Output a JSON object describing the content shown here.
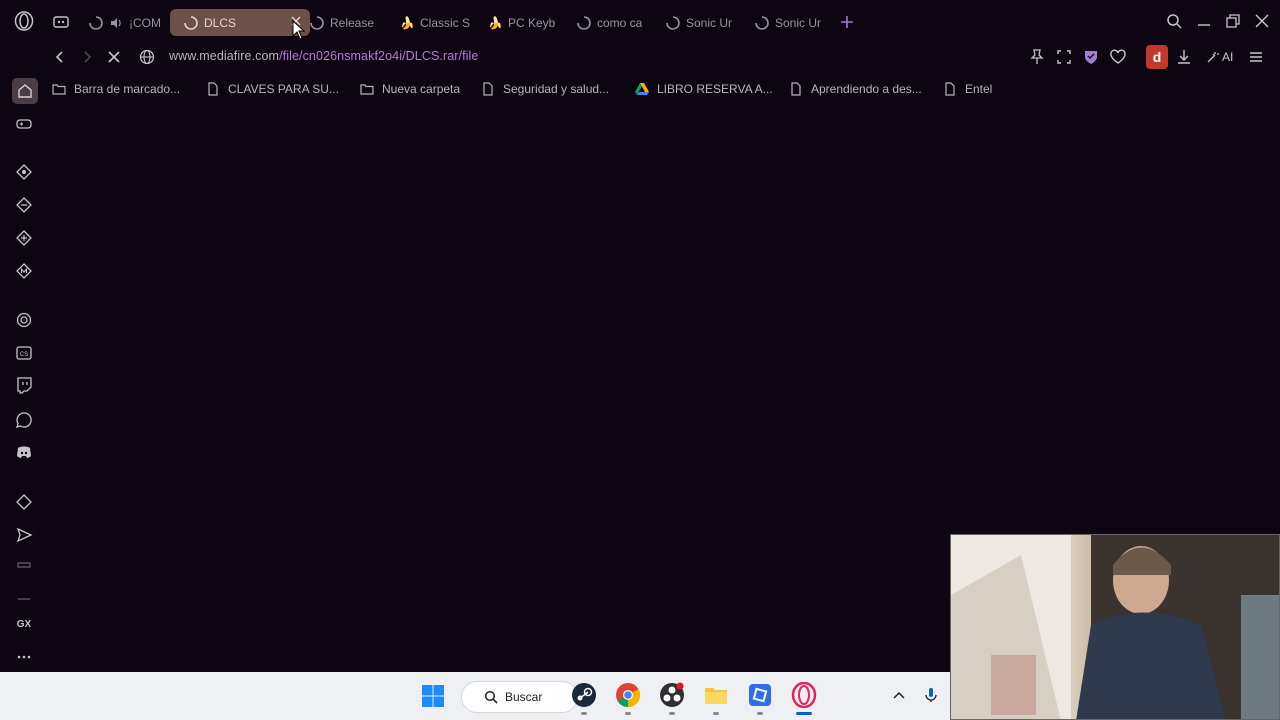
{
  "tabs": [
    {
      "label": "¡COM",
      "state": "loading"
    },
    {
      "label": "DLCS",
      "state": "active"
    },
    {
      "label": "Release",
      "state": "loading"
    },
    {
      "label": "Classic S",
      "state": "normal"
    },
    {
      "label": "PC Keyb",
      "state": "normal"
    },
    {
      "label": "como ca",
      "state": "loading"
    },
    {
      "label": "Sonic Ur",
      "state": "loading"
    },
    {
      "label": "Sonic Ur",
      "state": "loading"
    }
  ],
  "address_bar": {
    "host": "www.mediafire.com",
    "path": "/file/cn026nsmakf2o4i/DLCS.rar/file"
  },
  "toolbar": {
    "profile_initial": "d",
    "ai_label": "AI"
  },
  "bookmarks": [
    {
      "label": "Barra de marcado...",
      "icon": "folder-icon"
    },
    {
      "label": "CLAVES PARA SU...",
      "icon": "page-icon"
    },
    {
      "label": "Nueva carpeta",
      "icon": "folder-icon"
    },
    {
      "label": "Seguridad y salud...",
      "icon": "page-icon"
    },
    {
      "label": "LIBRO RESERVA A...",
      "icon": "drive-icon"
    },
    {
      "label": "Aprendiendo a des...",
      "icon": "page-icon"
    },
    {
      "label": "Entel",
      "icon": "page-icon"
    }
  ],
  "sidebar": {
    "gx_label": "GX",
    "items": [
      "home-icon",
      "gaming-icon",
      "extension-icon",
      "extension-icon",
      "extension-icon",
      "extension-icon",
      "chatgpt-icon",
      "cs-icon",
      "twitch-icon",
      "whatsapp-icon",
      "discord-icon",
      "extension-icon",
      "send-icon",
      "wallet-icon",
      "history-icon",
      "gx-icon",
      "more-icon"
    ]
  },
  "taskbar": {
    "search_label": "Buscar"
  },
  "colors": {
    "background": "#0d0612",
    "active_tab": "#6b5149",
    "url_path": "#b57ad6",
    "profile": "#c0392b",
    "taskbar": "#eef0f3"
  }
}
